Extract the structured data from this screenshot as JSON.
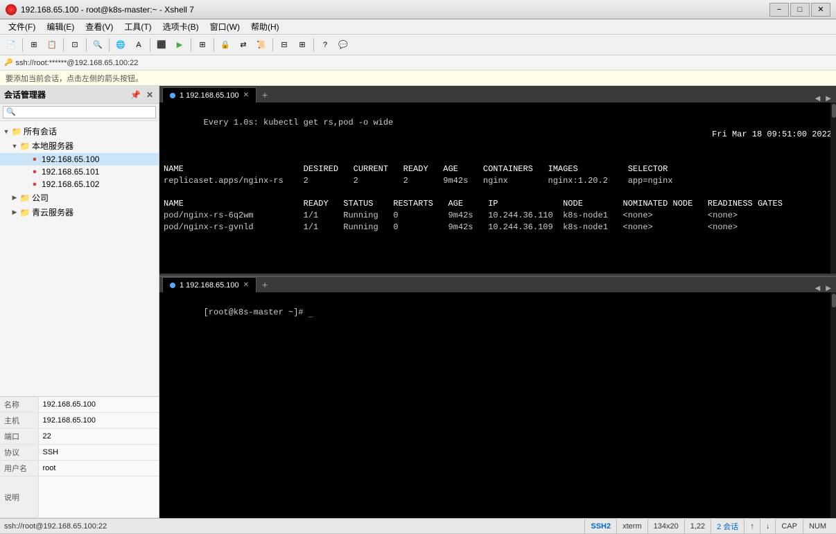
{
  "window": {
    "title": "192.168.65.100 - root@k8s-master:~ - Xshell 7",
    "icon": "●"
  },
  "menu": {
    "items": [
      "文件(F)",
      "编辑(E)",
      "查看(V)",
      "工具(T)",
      "选项卡(B)",
      "窗口(W)",
      "帮助(H)"
    ]
  },
  "session_bar": {
    "text": "ssh://root:******@192.168.65.100:22"
  },
  "info_banner": {
    "text": "要添加当前会话，点击左侧的箭头按钮。"
  },
  "sidebar": {
    "title": "会话管理器",
    "search_placeholder": "搜索",
    "tree": [
      {
        "level": 0,
        "type": "folder",
        "label": "所有会话",
        "expanded": true,
        "arrow": "▼"
      },
      {
        "level": 1,
        "type": "folder",
        "label": "本地服务器",
        "expanded": true,
        "arrow": "▼"
      },
      {
        "level": 2,
        "type": "server",
        "label": "192.168.65.100",
        "active": true
      },
      {
        "level": 2,
        "type": "server",
        "label": "192.168.65.101"
      },
      {
        "level": 2,
        "type": "server",
        "label": "192.168.65.102"
      },
      {
        "level": 1,
        "type": "folder",
        "label": "公司",
        "expanded": false,
        "arrow": "▶"
      },
      {
        "level": 1,
        "type": "folder",
        "label": "青云服务器",
        "expanded": false,
        "arrow": "▶"
      }
    ]
  },
  "info_panel": {
    "rows": [
      {
        "label": "名称",
        "value": "192.168.65.100"
      },
      {
        "label": "主机",
        "value": "192.168.65.100"
      },
      {
        "label": "端口",
        "value": "22"
      },
      {
        "label": "协议",
        "value": "SSH"
      },
      {
        "label": "用户名",
        "value": "root"
      },
      {
        "label": "说明",
        "value": ""
      }
    ]
  },
  "terminal_upper": {
    "tab_label": "1 192.168.65.100",
    "timestamp": "Fri Mar 18 09:51:00 2022",
    "watch_cmd": "Every 1.0s: kubectl get rs,pod -o wide",
    "lines": [
      "NAME                        DESIRED   CURRENT   READY   AGE     CONTAINERS   IMAGES          SELECTOR",
      "replicaset.apps/nginx-rs    2         2         2       9m42s   nginx        nginx:1.20.2    app=nginx",
      "",
      "NAME                        READY   STATUS    RESTARTS   AGE     IP             NODE        NOMINATED NODE   READINESS GATES",
      "pod/nginx-rs-6q2wm          1/1     Running   0          9m42s   10.244.36.110  k8s-node1   <none>           <none>",
      "pod/nginx-rs-gvnld          1/1     Running   0          9m42s   10.244.36.109  k8s-node1   <none>           <none>"
    ]
  },
  "terminal_lower": {
    "tab_label": "1 192.168.65.100",
    "prompt": "[root@k8s-master ~]# "
  },
  "status_bar": {
    "left_text": "ssh://root@192.168.65.100:22",
    "items": [
      {
        "label": "SSH2"
      },
      {
        "label": "xterm"
      },
      {
        "label": "134x20"
      },
      {
        "label": "1,22"
      },
      {
        "label": "2 会话"
      },
      {
        "label": "↑"
      },
      {
        "label": "↓"
      },
      {
        "label": "CAP"
      },
      {
        "label": "NUM"
      }
    ]
  }
}
